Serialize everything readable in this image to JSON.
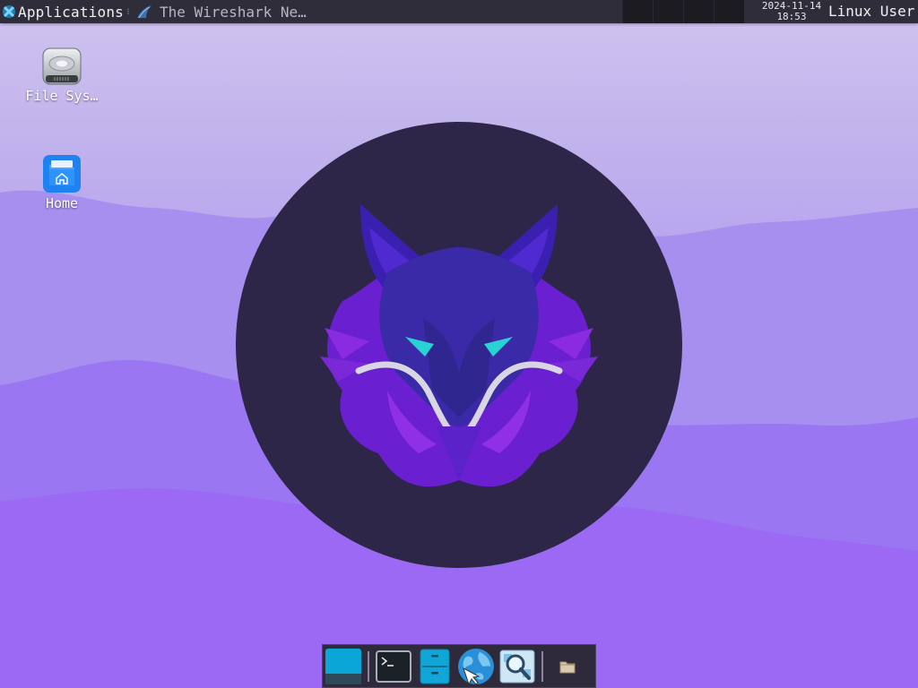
{
  "panel": {
    "applications_label": "Applications",
    "task_title": "The Wireshark Ne…",
    "clock_date": "2024-11-14",
    "clock_time": "18:53",
    "user_label": "Linux User",
    "workspaces": [
      "1",
      "2",
      "3",
      "4"
    ]
  },
  "desktop": {
    "icons": [
      {
        "label": "File Sys…",
        "icon": "hard-drive-icon"
      },
      {
        "label": "Home",
        "icon": "home-folder-icon"
      }
    ]
  },
  "dock": {
    "items": [
      {
        "name": "show-desktop",
        "icon": "desktop-icon"
      },
      {
        "name": "terminal",
        "icon": "terminal-icon"
      },
      {
        "name": "file-manager",
        "icon": "file-cabinet-icon"
      },
      {
        "name": "web-browser",
        "icon": "globe-icon"
      },
      {
        "name": "app-finder",
        "icon": "magnifier-icon"
      },
      {
        "name": "folder",
        "icon": "folder-icon"
      }
    ]
  },
  "colors": {
    "panel_bg": "#2f2d3a",
    "wallpaper_top": "#cfc4ef",
    "wallpaper_bottom": "#a35cf2",
    "emblem_bg": "#2d2648",
    "wolf_purple": "#7c2ee0",
    "wolf_eye": "#2ad1d4"
  }
}
